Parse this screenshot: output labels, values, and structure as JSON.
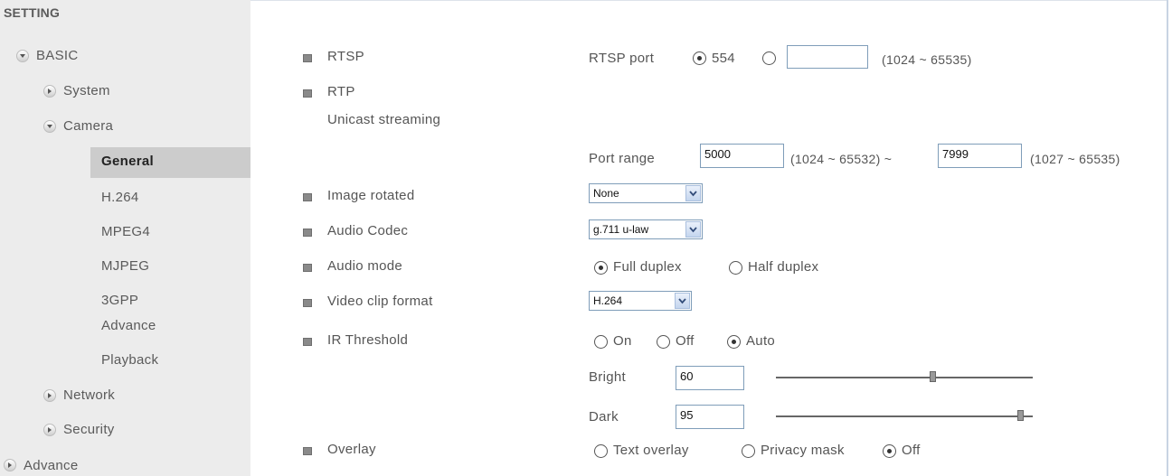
{
  "sidebar": {
    "title": "SETTING",
    "items": [
      {
        "label": "BASIC",
        "icon": "expanded-icon"
      },
      {
        "label": "System",
        "icon": "collapsed-icon"
      },
      {
        "label": "Camera",
        "icon": "expanded-icon"
      },
      {
        "label": "General",
        "selected": true
      },
      {
        "label": "H.264"
      },
      {
        "label": "MPEG4"
      },
      {
        "label": "MJPEG"
      },
      {
        "label": "3GPP"
      },
      {
        "label": "Advance"
      },
      {
        "label": "Playback"
      },
      {
        "label": "Network",
        "icon": "collapsed-icon"
      },
      {
        "label": "Security",
        "icon": "collapsed-icon"
      },
      {
        "label": "Advance",
        "icon": "collapsed-icon"
      }
    ]
  },
  "form": {
    "rtsp": {
      "label": "RTSP",
      "port_label": "RTSP port",
      "default_option": "554",
      "custom_value": "",
      "range": "(1024 ~ 65535)"
    },
    "rtp": {
      "label": "RTP",
      "unicast_label": "Unicast streaming",
      "port_range_label": "Port range",
      "start": "5000",
      "start_range": "(1024 ~ 65532) ~",
      "end": "7999",
      "end_range": "(1027 ~ 65535)"
    },
    "image_rotated": {
      "label": "Image rotated",
      "value": "None"
    },
    "audio_codec": {
      "label": "Audio Codec",
      "value": "g.711 u-law"
    },
    "audio_mode": {
      "label": "Audio mode",
      "options": [
        "Full duplex",
        "Half duplex"
      ],
      "selected": "Full duplex"
    },
    "video_clip_format": {
      "label": "Video clip format",
      "value": "H.264"
    },
    "ir_threshold": {
      "label": "IR Threshold",
      "options": [
        "On",
        "Off",
        "Auto"
      ],
      "selected": "Auto",
      "bright_label": "Bright",
      "bright_value": "60",
      "bright_level": 0.61,
      "dark_label": "Dark",
      "dark_value": "95",
      "dark_level": 0.95
    },
    "overlay": {
      "label": "Overlay",
      "options": [
        "Text overlay",
        "Privacy mask",
        "Off"
      ],
      "selected": "Off"
    }
  }
}
